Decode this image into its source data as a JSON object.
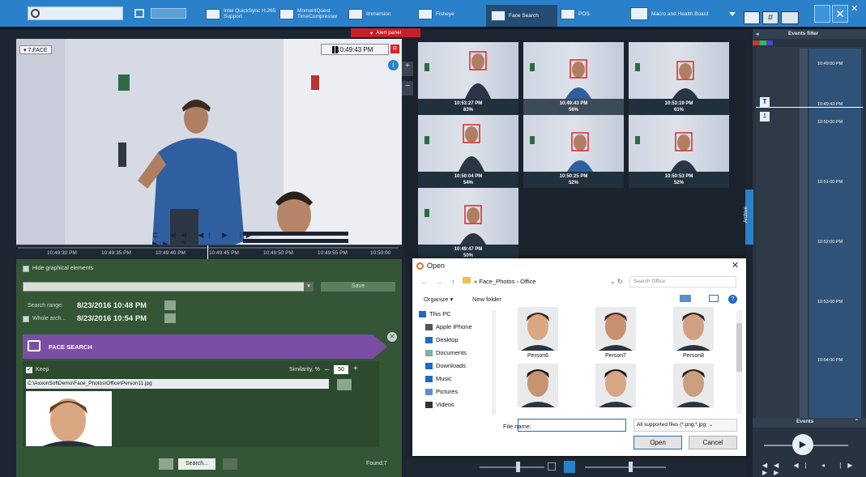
{
  "topbar": {
    "search_placeholder": "",
    "tabs": [
      {
        "label": "Intel QuickSync H.265 Support"
      },
      {
        "label": "MomentQuest TimeCompressor"
      },
      {
        "label": "Immersion"
      },
      {
        "label": "Fisheye"
      },
      {
        "label": "Face Search"
      },
      {
        "label": "POS"
      },
      {
        "label": "Macro and Health Board"
      }
    ]
  },
  "alert_panel": {
    "label": "Alert panel"
  },
  "video": {
    "camera_label": "7.FACE",
    "timestamp": "10:49:43 PM",
    "timeline_ticks": [
      "10:49:30 PM",
      "10:49:35 PM",
      "10:49:40 PM",
      "10:49:45 PM",
      "10:49:50 PM",
      "10:49:55 PM",
      "10:50:00"
    ]
  },
  "left_panel": {
    "hide_graphical": "Hide graphical elements",
    "save_label": "Save",
    "search_range_label": "Search range:",
    "search_range_from": "8/23/2016 10:48 PM",
    "whole_archive_label": "Whole arch...",
    "search_range_to": "8/23/2016 10:54 PM",
    "face_search_title": "FACE SEARCH",
    "keep_label": "Keep",
    "similarity_label": "Similarity, %",
    "similarity_value": "50",
    "file_path": "C:\\AxxonSoftDemo\\Face_Photos\\Office\\Person11.jpg",
    "search_button": "Search...",
    "found_label": "Found:7"
  },
  "results": [
    {
      "time": "10:53:27 PM",
      "pct": "83%"
    },
    {
      "time": "10:49:43 PM",
      "pct": "56%"
    },
    {
      "time": "10:53:19 PM",
      "pct": "61%"
    },
    {
      "time": "10:50:04 PM",
      "pct": "54%"
    },
    {
      "time": "10:50:25 PM",
      "pct": "52%"
    },
    {
      "time": "10:50:53 PM",
      "pct": "52%"
    },
    {
      "time": "10:49:47 PM",
      "pct": "50%"
    }
  ],
  "right_panel": {
    "events_filter": "Events filter",
    "selected_time": "10:49:43 PM",
    "time_marks": [
      "10:49:00 PM",
      "10:50:00 PM",
      "10:51:00 PM",
      "10:52:00 PM",
      "10:53:00 PM",
      "10:54:00 PM"
    ],
    "archive_label": "Archive",
    "events_label": "Events"
  },
  "dialog": {
    "title": "Open",
    "breadcrumb": [
      "Face_Photos",
      "Office"
    ],
    "search_placeholder": "Search Office",
    "organize": "Organize ▾",
    "new_folder": "New folder",
    "nav_items": [
      "This PC",
      "Apple iPhone",
      "Desktop",
      "Documents",
      "Downloads",
      "Music",
      "Pictures",
      "Videos"
    ],
    "files": [
      "Person6",
      "Person7",
      "Person8",
      "",
      "",
      ""
    ],
    "file_name_label": "File name:",
    "file_name_value": "",
    "filter_label": "All supported files (*.png;*.jpg;",
    "open_button": "Open",
    "cancel_button": "Cancel"
  },
  "colors": {
    "topbar": "#2b81c9",
    "left_panel": "#345636",
    "face_search_header": "#7a4fa3",
    "alert": "#c81f26",
    "face_box": "#e0242a"
  }
}
